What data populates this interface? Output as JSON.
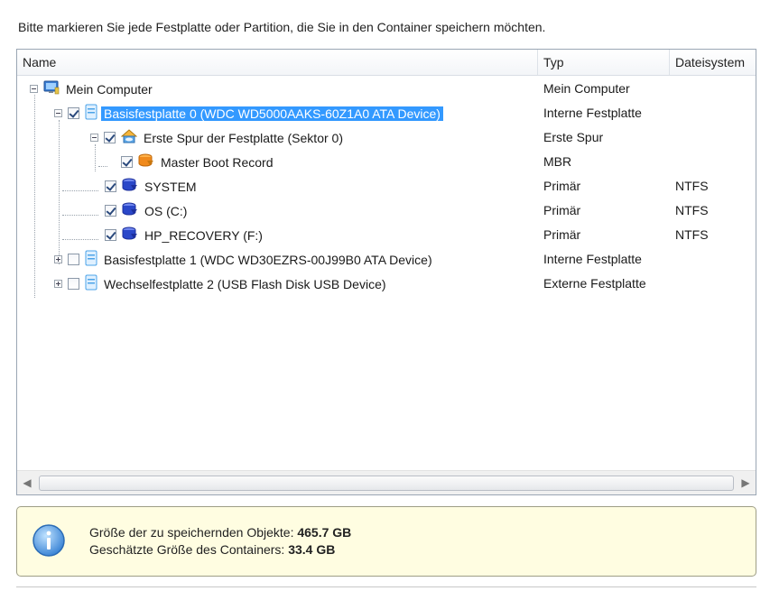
{
  "instruction": "Bitte markieren Sie jede Festplatte oder Partition, die Sie in den Container speichern möchten.",
  "columns": {
    "name": "Name",
    "type": "Typ",
    "fs": "Dateisystem"
  },
  "rows": [
    {
      "name": "Mein Computer",
      "type": "Mein Computer",
      "fs": "",
      "icon": "computer-icon"
    },
    {
      "name": "Basisfestplatte 0 (WDC WD5000AAKS-60Z1A0 ATA Device)",
      "type": "Interne Festplatte",
      "fs": "",
      "icon": "hard-disk-icon",
      "checked": true,
      "selected": true
    },
    {
      "name": "Erste Spur der Festplatte (Sektor 0)",
      "type": "Erste Spur",
      "fs": "",
      "icon": "first-track-icon",
      "checked": true
    },
    {
      "name": "Master Boot Record",
      "type": "MBR",
      "fs": "",
      "icon": "mbr-icon",
      "checked": true
    },
    {
      "name": "SYSTEM",
      "type": "Primär",
      "fs": "NTFS",
      "icon": "partition-icon",
      "checked": true
    },
    {
      "name": "OS (C:)",
      "type": "Primär",
      "fs": "NTFS",
      "icon": "partition-icon",
      "checked": true
    },
    {
      "name": "HP_RECOVERY (F:)",
      "type": "Primär",
      "fs": "NTFS",
      "icon": "partition-icon",
      "checked": true
    },
    {
      "name": "Basisfestplatte 1 (WDC WD30EZRS-00J99B0 ATA Device)",
      "type": "Interne Festplatte",
      "fs": "",
      "icon": "hard-disk-icon",
      "checked": false
    },
    {
      "name": "Wechselfestplatte 2 (USB Flash Disk USB Device)",
      "type": "Externe Festplatte",
      "fs": "",
      "icon": "removable-disk-icon",
      "checked": false
    }
  ],
  "info": {
    "size_label": "Größe der zu speichernden Objekte:",
    "size_value": "465.7 GB",
    "container_label": "Geschätzte Größe des Containers:",
    "container_value": "33.4 GB"
  },
  "colors": {
    "selection": "#3399ff",
    "info_background": "#fffde1",
    "partition_icon": "#2a47c9",
    "mbr_icon": "#f08a1c",
    "disk_icon": "#4ba3e8"
  }
}
